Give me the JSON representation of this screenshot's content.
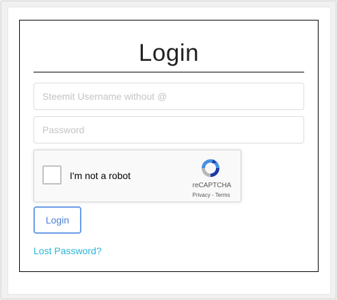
{
  "form": {
    "title": "Login",
    "username_placeholder": "Steemit Username without @",
    "password_placeholder": "Password",
    "login_label": "Login",
    "lost_password_label": "Lost Password?"
  },
  "recaptcha": {
    "checkbox_label": "I'm not a robot",
    "brand": "reCAPTCHA",
    "links": "Privacy - Terms",
    "logo_icon": "recaptcha-logo-icon",
    "checked": false
  },
  "colors": {
    "button_border": "#6a9be6",
    "link": "#2bb3d6"
  }
}
